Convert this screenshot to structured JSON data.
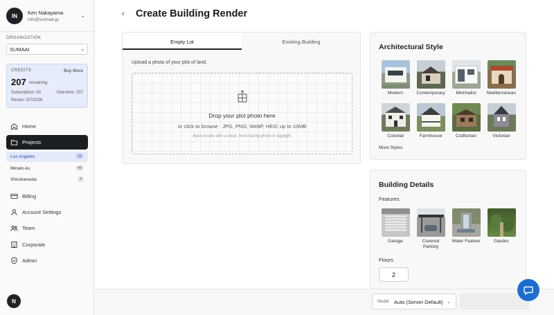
{
  "user": {
    "initials": "IN",
    "name": "Ken Nakayama",
    "email": "info@sumaai.jp"
  },
  "organization": {
    "label": "ORGANIZATION",
    "selected": "SUMAAI"
  },
  "credits": {
    "label": "CREDITS",
    "buy_more": "Buy More",
    "remaining_count": "207",
    "remaining_label": "remaining",
    "subscription": "Subscription: 50",
    "one_time": "One-time: 157",
    "resets": "Resets: 5/7/2026"
  },
  "nav": {
    "home": "Home",
    "projects": "Projects",
    "projects_sub": [
      {
        "label": "Los Angeles",
        "count": "23"
      },
      {
        "label": "Minato-ku",
        "count": "48"
      },
      {
        "label": "Shirokanedai",
        "count": "9"
      }
    ],
    "billing": "Billing",
    "account_settings": "Account Settings",
    "team": "Team",
    "corporate": "Corporate",
    "admin": "Admin"
  },
  "footer_badge": "N",
  "page": {
    "title": "Create Building Render"
  },
  "tabs": {
    "empty_lot": "Empty Lot",
    "existing_building": "Existing Building"
  },
  "upload": {
    "hint": "Upload a photo of your plot of land.",
    "drop_title": "Drop your plot photo here",
    "drop_sub": "or click to browse · JPG, PNG, WebP, HEIC up to 10MB",
    "drop_tip": "Best results with a clear, front-facing photo in daylight"
  },
  "arch": {
    "title": "Architectural Style",
    "styles": [
      "Modern",
      "Contemporary",
      "Minimalist",
      "Mediterranean",
      "Colonial",
      "Farmhouse",
      "Craftsman",
      "Victorian"
    ],
    "more": "More Styles"
  },
  "details": {
    "title": "Building Details",
    "features_label": "Features",
    "features": [
      "Garage",
      "Covered Parking",
      "Water Feature",
      "Garden"
    ],
    "floors_label": "Floors",
    "floors_value": "2"
  },
  "model": {
    "label": "Model:",
    "value": "Auto (Server Default)"
  },
  "colors": {
    "accent": "#1c6dd0",
    "nav_active": "#1c1f22",
    "sub_active_bg": "#e4eaf9"
  }
}
